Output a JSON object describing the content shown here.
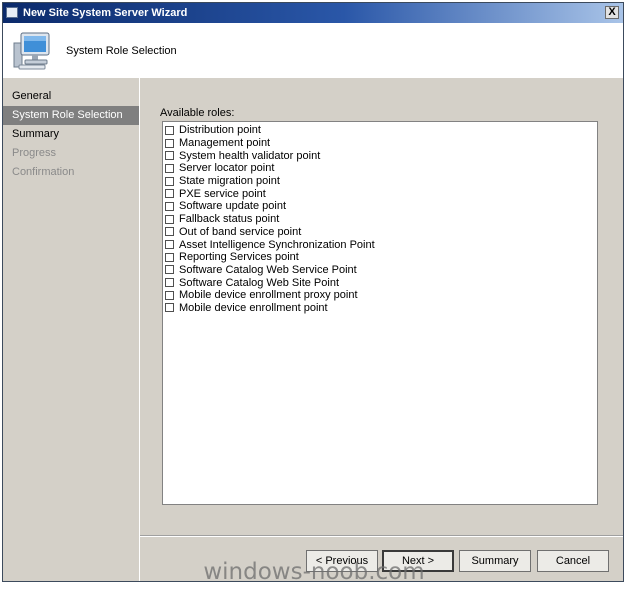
{
  "window": {
    "title": "New Site System Server Wizard",
    "close_glyph": "X"
  },
  "header": {
    "title": "System Role Selection",
    "icon": "computer-icon"
  },
  "nav": {
    "items": [
      {
        "label": "General",
        "state": "normal"
      },
      {
        "label": "System Role Selection",
        "state": "current"
      },
      {
        "label": "Summary",
        "state": "normal"
      },
      {
        "label": "Progress",
        "state": "disabled"
      },
      {
        "label": "Confirmation",
        "state": "disabled"
      }
    ]
  },
  "roles": {
    "label": "Available roles:",
    "items": [
      {
        "label": "Distribution point",
        "checked": false
      },
      {
        "label": "Management point",
        "checked": false
      },
      {
        "label": "System health validator point",
        "checked": false
      },
      {
        "label": "Server locator point",
        "checked": false
      },
      {
        "label": "State migration point",
        "checked": false
      },
      {
        "label": "PXE service point",
        "checked": false
      },
      {
        "label": "Software update point",
        "checked": false
      },
      {
        "label": "Fallback status point",
        "checked": false
      },
      {
        "label": "Out of band service point",
        "checked": false
      },
      {
        "label": "Asset Intelligence Synchronization Point",
        "checked": false
      },
      {
        "label": "Reporting Services point",
        "checked": false
      },
      {
        "label": "Software Catalog Web Service Point",
        "checked": false
      },
      {
        "label": "Software Catalog Web Site Point",
        "checked": false
      },
      {
        "label": "Mobile device enrollment proxy point",
        "checked": false
      },
      {
        "label": "Mobile device enrollment point",
        "checked": false
      }
    ]
  },
  "buttons": {
    "previous": "< Previous",
    "next": "Next >",
    "summary": "Summary",
    "cancel": "Cancel"
  },
  "watermark": "windows-noob.com"
}
